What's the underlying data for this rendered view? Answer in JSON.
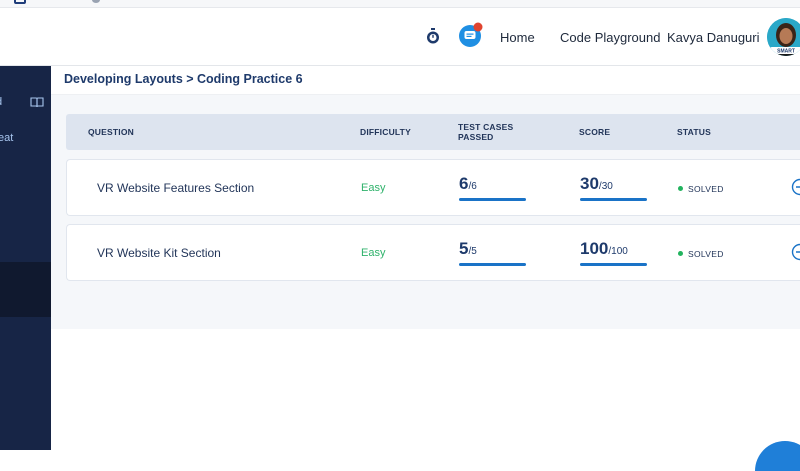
{
  "header": {
    "nav": {
      "home": "Home",
      "playground": "Code Playground"
    },
    "user_name": "Kavya Danuguri",
    "avatar_badge": "SMART",
    "chat_notification_color": "#e0442f"
  },
  "sidebar": {
    "item1_fragment": "d",
    "item2_fragment": "eat"
  },
  "main": {
    "breadcrumb": "Developing Layouts > Coding Practice 6",
    "table": {
      "headers": {
        "question": "QUESTION",
        "difficulty": "DIFFICULTY",
        "test_cases_line1": "TEST CASES",
        "test_cases_line2": "PASSED",
        "score": "SCORE",
        "status": "STATUS"
      },
      "rows": [
        {
          "question": "VR Website Features Section",
          "difficulty": "Easy",
          "tests_passed": "6",
          "tests_total": "/6",
          "score": "30",
          "score_total": "/30",
          "status": "SOLVED"
        },
        {
          "question": "VR Website Kit Section",
          "difficulty": "Easy",
          "tests_passed": "5",
          "tests_total": "/5",
          "score": "100",
          "score_total": "/100",
          "status": "SOLVED"
        }
      ]
    }
  },
  "colors": {
    "sidebar": "#172546",
    "accent_blue": "#1a73c7",
    "easy_green": "#2fb26b",
    "solved_dot": "#22b35e"
  }
}
